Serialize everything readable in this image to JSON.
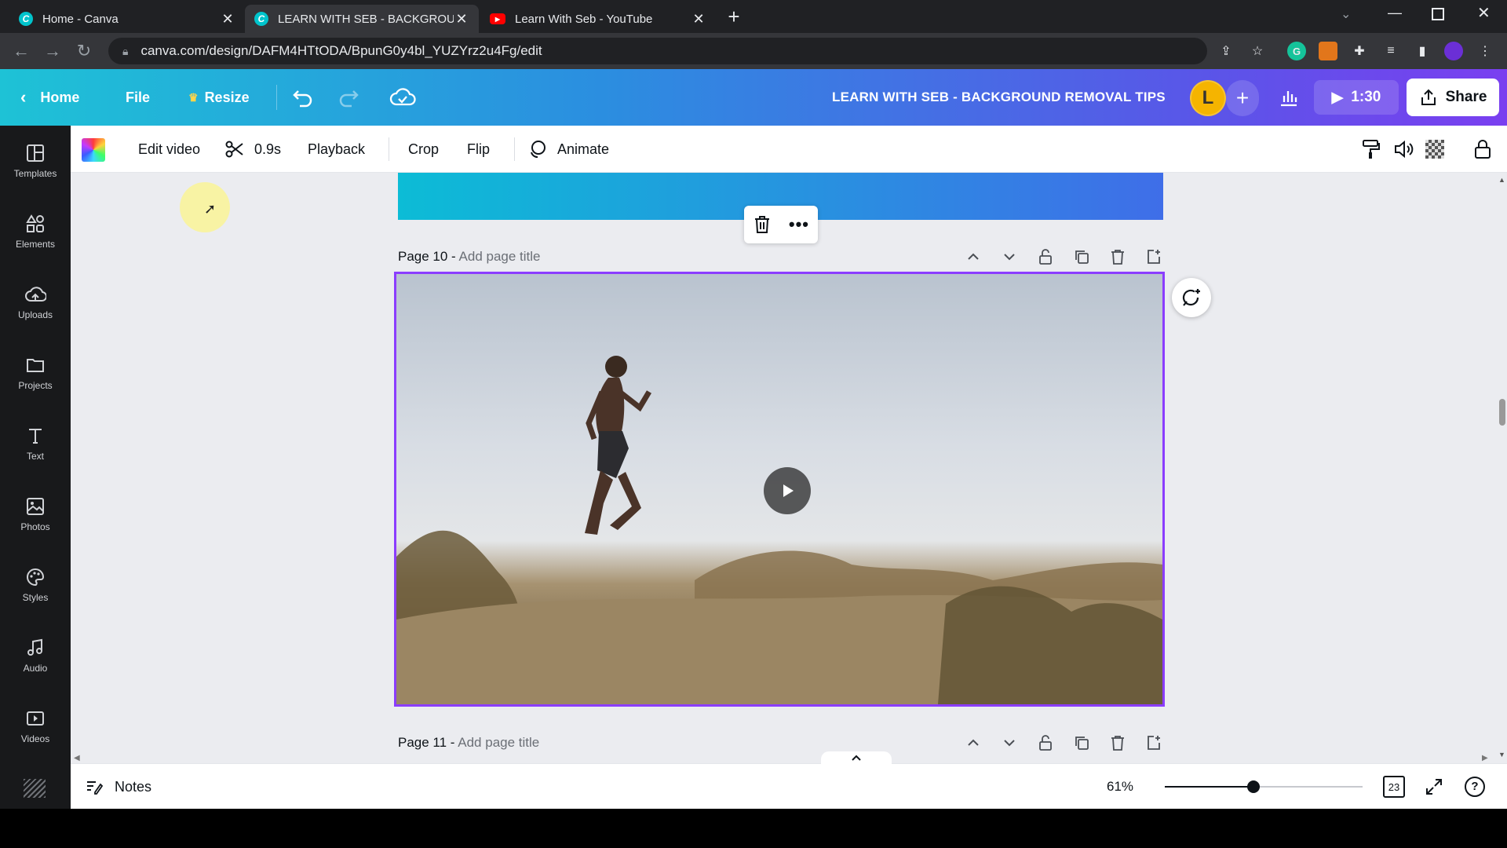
{
  "browser": {
    "tabs": [
      {
        "title": "Home - Canva",
        "active": false
      },
      {
        "title": "LEARN WITH SEB - BACKGROUN",
        "active": true
      },
      {
        "title": "Learn With Seb - YouTube",
        "active": false
      }
    ],
    "url": "canva.com/design/DAFM4HTtODA/BpunG0y4bl_YUZYrz2u4Fg/edit"
  },
  "header": {
    "home_label": "Home",
    "file_label": "File",
    "resize_label": "Resize",
    "design_title": "LEARN WITH SEB - BACKGROUND REMOVAL TIPS",
    "avatar_initial": "L",
    "present_time": "1:30",
    "share_label": "Share"
  },
  "sidebar": {
    "items": [
      {
        "label": "Templates",
        "icon": "templates-icon"
      },
      {
        "label": "Elements",
        "icon": "elements-icon"
      },
      {
        "label": "Uploads",
        "icon": "uploads-icon"
      },
      {
        "label": "Projects",
        "icon": "projects-icon"
      },
      {
        "label": "Text",
        "icon": "text-icon"
      },
      {
        "label": "Photos",
        "icon": "photos-icon"
      },
      {
        "label": "Styles",
        "icon": "styles-icon"
      },
      {
        "label": "Audio",
        "icon": "audio-icon"
      },
      {
        "label": "Videos",
        "icon": "videos-icon"
      }
    ]
  },
  "toolbar": {
    "edit_video": "Edit video",
    "trim_duration": "0.9s",
    "playback": "Playback",
    "crop": "Crop",
    "flip": "Flip",
    "animate": "Animate"
  },
  "pages": [
    {
      "label": "Page 10 -",
      "placeholder": "Add page title"
    },
    {
      "label": "Page 11 -",
      "placeholder": "Add page title"
    }
  ],
  "footer": {
    "notes_label": "Notes",
    "zoom": "61%",
    "zoom_fraction": 0.45,
    "page_count": "23"
  },
  "colors": {
    "selection": "#8b3dff",
    "header_start": "#1ec2d6",
    "header_end": "#7a3ff0"
  }
}
